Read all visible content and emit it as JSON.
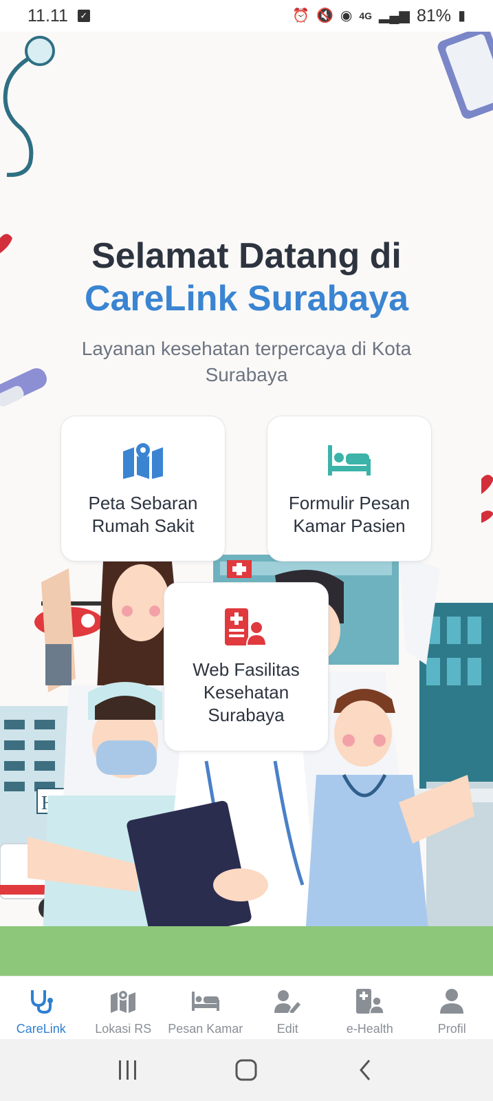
{
  "status_bar": {
    "time": "11.11",
    "battery": "81%",
    "network": "4G"
  },
  "hero": {
    "title_line1": "Selamat Datang di",
    "title_line2": "CareLink Surabaya",
    "subtitle": "Layanan kesehatan terpercaya di Kota Surabaya"
  },
  "cards": {
    "peta": {
      "label": "Peta Sebaran Rumah Sakit",
      "icon": "map-icon"
    },
    "formulir": {
      "label": "Formulir Pesan Kamar Pasien",
      "icon": "bed-icon"
    },
    "web": {
      "label": "Web Fasilitas Kesehatan Surabaya",
      "icon": "medical-staff-icon"
    }
  },
  "bottom_nav": {
    "items": [
      {
        "label": "CareLink",
        "icon": "stethoscope-icon",
        "active": true
      },
      {
        "label": "Lokasi RS",
        "icon": "map-icon",
        "active": false
      },
      {
        "label": "Pesan Kamar",
        "icon": "bed-icon",
        "active": false
      },
      {
        "label": "Edit",
        "icon": "user-edit-icon",
        "active": false
      },
      {
        "label": "e-Health",
        "icon": "medical-user-icon",
        "active": false
      },
      {
        "label": "Profil",
        "icon": "user-icon",
        "active": false
      }
    ]
  },
  "colors": {
    "accent_blue": "#3a84d2",
    "teal": "#3bb3a8",
    "red": "#e0393e",
    "nav_active": "#2f7fd0",
    "nav_inactive": "#8a8f96"
  }
}
